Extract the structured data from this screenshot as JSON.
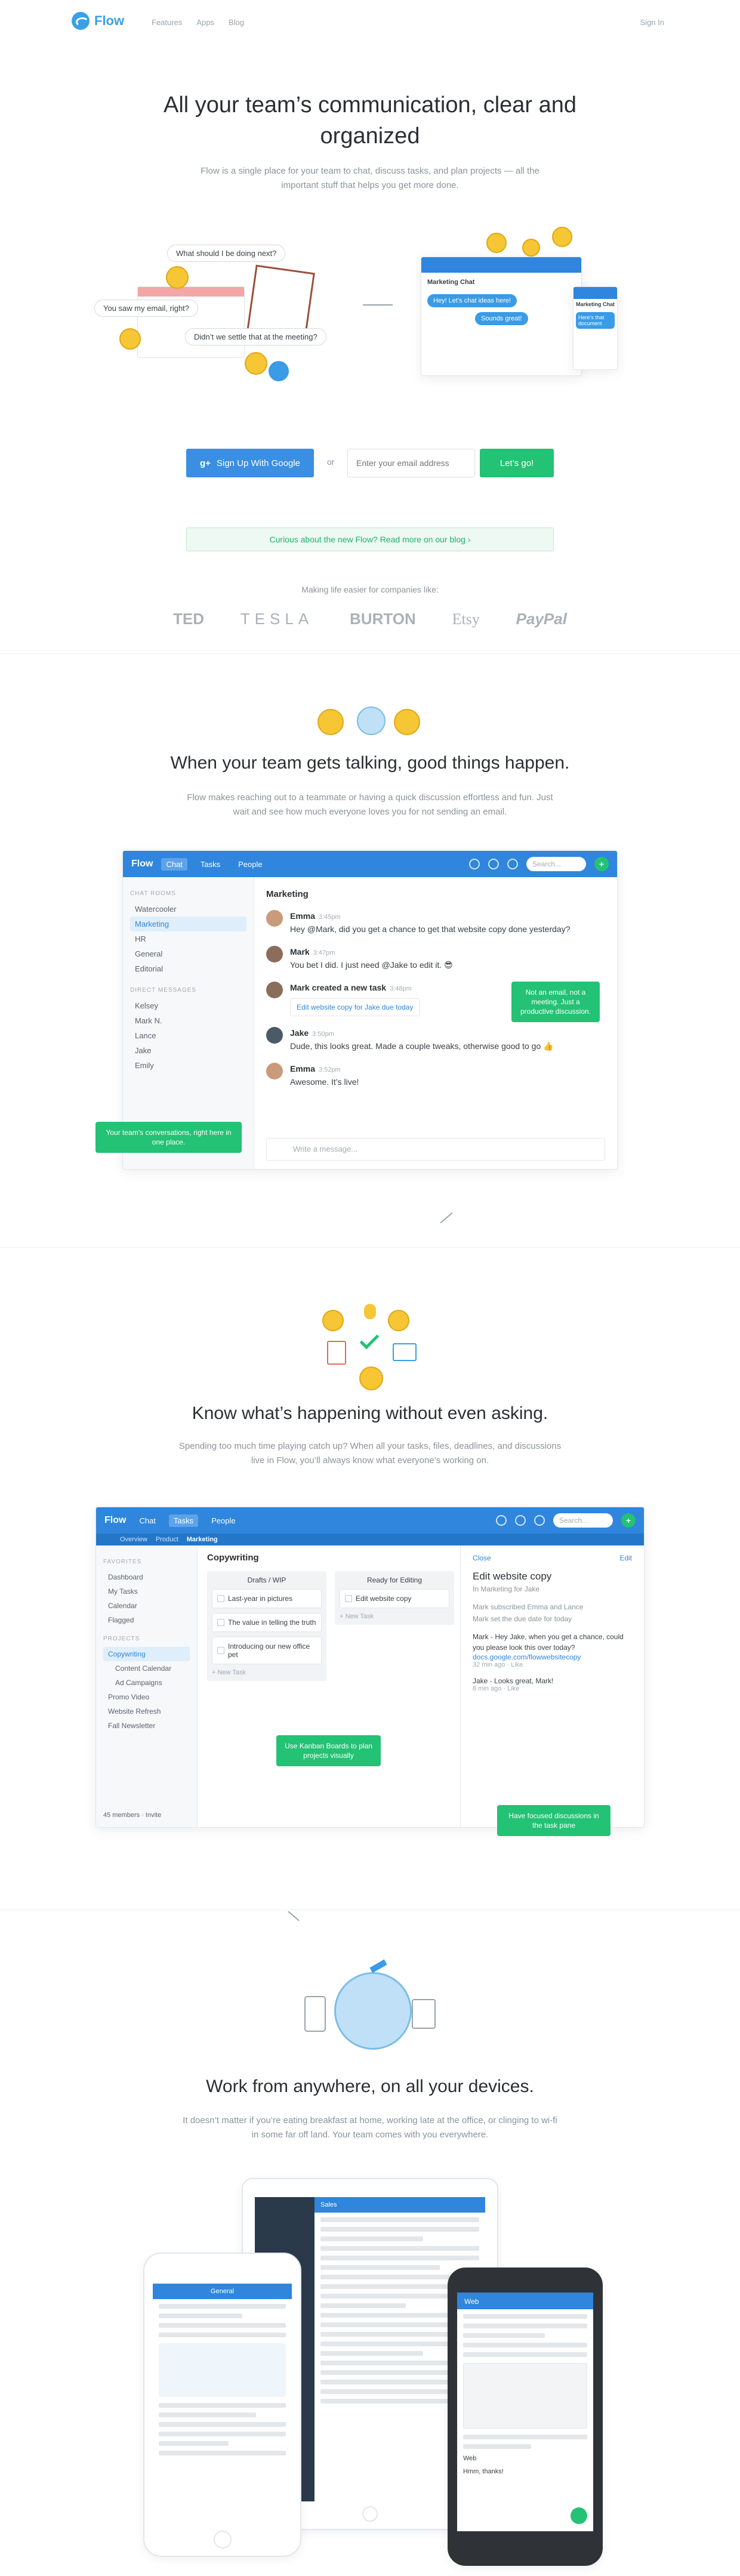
{
  "nav": {
    "logo": "Flow",
    "links": [
      "Features",
      "Apps",
      "Blog"
    ],
    "signin": "Sign In"
  },
  "hero": {
    "title": "All your team’s communication, clear and organized",
    "subtitle": "Flow is a single place for your team to chat, discuss tasks, and plan projects — all the important stuff that helps you get more done.",
    "bubbles": [
      "What should I be doing next?",
      "You saw my email, right?",
      "Didn’t we settle that at the meeting?"
    ],
    "preview": {
      "title": "Marketing Chat",
      "msg1": "Hey! Let’s chat ideas here!",
      "msg2": "Sounds great!",
      "mobile_title": "Marketing Chat",
      "mobile_msg": "Here’s that document"
    }
  },
  "signup": {
    "google_label": "Sign Up With Google",
    "or": "or",
    "email_placeholder": "Enter your email address",
    "go_label": "Let’s go!"
  },
  "blog_banner": "Curious about the new Flow? Read more on our blog ›",
  "companies": {
    "caption": "Making life easier for companies like:",
    "names": [
      "TED",
      "TESLA",
      "BURTON",
      "Etsy",
      "PayPal"
    ]
  },
  "talk": {
    "title": "When your team gets talking, good things happen.",
    "subtitle": "Flow makes reaching out to a teammate or having a quick discussion effortless and fun. Just wait and see how much everyone loves you for not sending an email.",
    "app": {
      "brand": "Flow",
      "tabs": [
        "Chat",
        "Tasks",
        "People"
      ],
      "search": "Search...",
      "rooms_header": "CHAT ROOMS",
      "rooms": [
        "Watercooler",
        "Marketing",
        "HR",
        "General",
        "Editorial"
      ],
      "dm_header": "DIRECT MESSAGES",
      "dms": [
        "Kelsey",
        "Mark N.",
        "Lance",
        "Jake",
        "Emily"
      ],
      "channel": "Marketing",
      "messages": [
        {
          "name": "Emma",
          "time": "3:45pm",
          "text": "Hey @Mark, did you get a chance to get that website copy done yesterday?"
        },
        {
          "name": "Mark",
          "time": "3:47pm",
          "text": "You bet I did. I just need @Jake to edit it. 😎"
        },
        {
          "name": "Mark created a new task",
          "time": "3:48pm",
          "text": "Edit website copy  for Jake due today"
        },
        {
          "name": "Jake",
          "time": "3:50pm",
          "text": "Dude, this looks great. Made a couple tweaks, otherwise good to go 👍"
        },
        {
          "name": "Emma",
          "time": "3:52pm",
          "text": "Awesome. It’s live!"
        }
      ],
      "composer": "Write a message..."
    },
    "tip_right": "Not an email, not a meeting. Just a productive discussion.",
    "tip_left": "Your team’s conversations, right here in one place."
  },
  "know": {
    "title": "Know what’s happening without even asking.",
    "subtitle": "Spending too much time playing catch up? When all your tasks, files, deadlines, and discussions live in Flow, you’ll always know what everyone’s working on.",
    "app": {
      "brand": "Flow",
      "tabs": [
        "Chat",
        "Tasks",
        "People"
      ],
      "search": "Search...",
      "subnav": [
        "Overview",
        "Product",
        "Marketing"
      ],
      "fav_header": "FAVORITES",
      "favorites": [
        "Dashboard",
        "My Tasks",
        "Calendar",
        "Flagged"
      ],
      "proj_header": "PROJECTS",
      "projects": [
        "Copywriting",
        "Content Calendar",
        "Ad Campaigns",
        "Promo Video",
        "Website Refresh",
        "Fall Newsletter"
      ],
      "members": "45 members · Invite",
      "board_title": "Copywriting",
      "columns": [
        {
          "name": "Drafts / WIP",
          "cards": [
            "Last-year in pictures",
            "The value in telling the truth",
            "Introducing our new office pet"
          ],
          "add": "+ New Task"
        },
        {
          "name": "Ready for Editing",
          "cards": [
            "Edit website copy"
          ],
          "add": "+ New Task"
        }
      ],
      "pane": {
        "close": "Close",
        "edit": "Edit",
        "task": "Edit website copy",
        "in": "In Marketing for Jake",
        "activity": [
          "Mark subscribed Emma and Lance",
          "Mark set the due date for today"
        ],
        "comment1": "Mark - Hey Jake, when you get a chance, could you please look this over today?",
        "link": "docs.google.com/flowwebsitecopy",
        "time1": "32 min ago · Like",
        "comment2": "Jake - Looks great, Mark!",
        "time2": "8 min ago · Like"
      }
    },
    "tip_board": "Use Kanban Boards to plan projects visually",
    "tip_pane": "Have focused discussions in the task pane"
  },
  "devices": {
    "title": "Work from anywhere, on all your devices.",
    "subtitle": "It doesn’t matter if you’re eating breakfast at home, working late at the office, or clinging to wi-fi in some far off land. Your team comes with you everywhere.",
    "tablet_header": "Sales",
    "phone_header": "General",
    "android_header": "Web",
    "android_msg": "Hmm, thanks!"
  },
  "colors": {
    "brand": "#2f86dc",
    "green": "#23c274",
    "google": "#3a8fe3"
  }
}
